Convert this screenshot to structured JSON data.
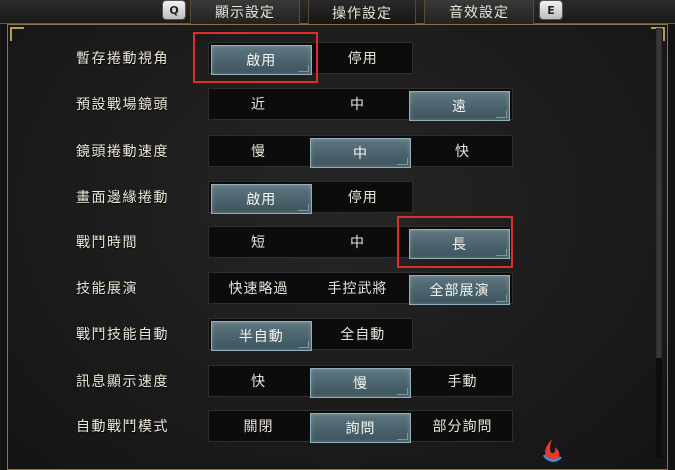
{
  "tabs": {
    "left_key": "Q",
    "right_key": "E",
    "items": [
      {
        "label": "顯示設定",
        "active": false
      },
      {
        "label": "操作設定",
        "active": true
      },
      {
        "label": "音效設定",
        "active": false
      }
    ]
  },
  "settings": [
    {
      "label": "暫存捲動視角",
      "options": [
        "啟用",
        "停用"
      ],
      "selected": 0
    },
    {
      "label": "預設戰場鏡頭",
      "options": [
        "近",
        "中",
        "遠"
      ],
      "selected": 2
    },
    {
      "label": "鏡頭捲動速度",
      "options": [
        "慢",
        "中",
        "快"
      ],
      "selected": 1
    },
    {
      "label": "畫面邊緣捲動",
      "options": [
        "啟用",
        "停用"
      ],
      "selected": 0
    },
    {
      "label": "戰鬥時間",
      "options": [
        "短",
        "中",
        "長"
      ],
      "selected": 2
    },
    {
      "label": "技能展演",
      "options": [
        "快速略過",
        "手控武將",
        "全部展演"
      ],
      "selected": 2
    },
    {
      "label": "戰鬥技能自動",
      "options": [
        "半自動",
        "全自動"
      ],
      "selected": 0
    },
    {
      "label": "訊息顯示速度",
      "options": [
        "快",
        "慢",
        "手動"
      ],
      "selected": 1
    },
    {
      "label": "自動戰鬥模式",
      "options": [
        "關閉",
        "詢問",
        "部分詢問"
      ],
      "selected": 1
    }
  ],
  "colors": {
    "highlight_box": "#e02c2c",
    "selected_button": "#4d6770",
    "panel_border": "#8a7446"
  },
  "icons": {
    "watermark": "flame-logo-icon"
  }
}
